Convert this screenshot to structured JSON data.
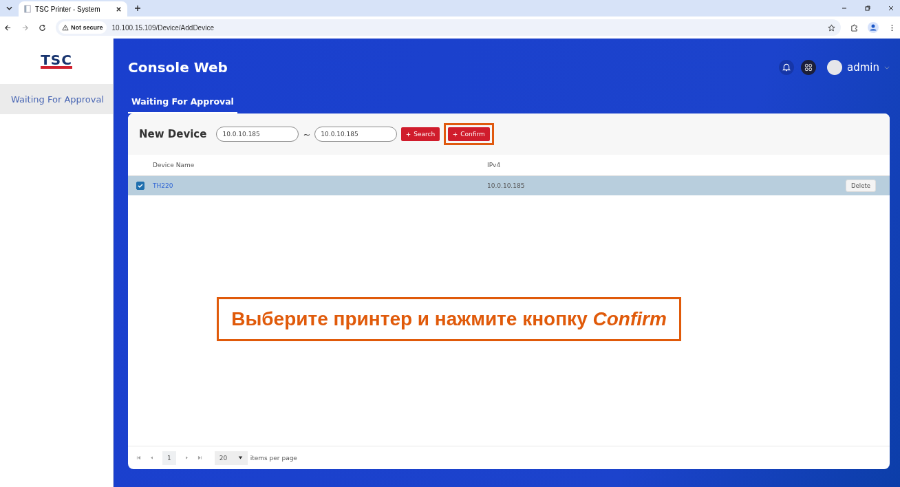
{
  "browser": {
    "tab_title": "TSC Printer - System",
    "security": "Not secure",
    "url": "10.100.15.109/Device/AddDevice"
  },
  "sidebar": {
    "logo": "TSC",
    "items": [
      {
        "label": "Waiting For Approval",
        "selected": true
      }
    ]
  },
  "header": {
    "title": "Console Web",
    "user": "admin"
  },
  "tabs": [
    {
      "label": "Waiting For Approval",
      "selected": true
    }
  ],
  "toolbar": {
    "title": "New Device",
    "from": "10.0.10.185",
    "separator": "~",
    "to": "10.0.10.185",
    "search": "Search",
    "confirm": "Confirm",
    "confirm_highlighted": true
  },
  "table": {
    "columns": [
      "Device Name",
      "IPv4"
    ],
    "rows": [
      {
        "name": "TH220",
        "ipv4": "10.0.10.185",
        "action": "Delete",
        "checked": true,
        "selected": true
      }
    ]
  },
  "pager": {
    "page": "1",
    "page_size": "20",
    "label": "items per page"
  },
  "callout": "Выберите принтер и нажмите кнопку *Confirm*"
}
